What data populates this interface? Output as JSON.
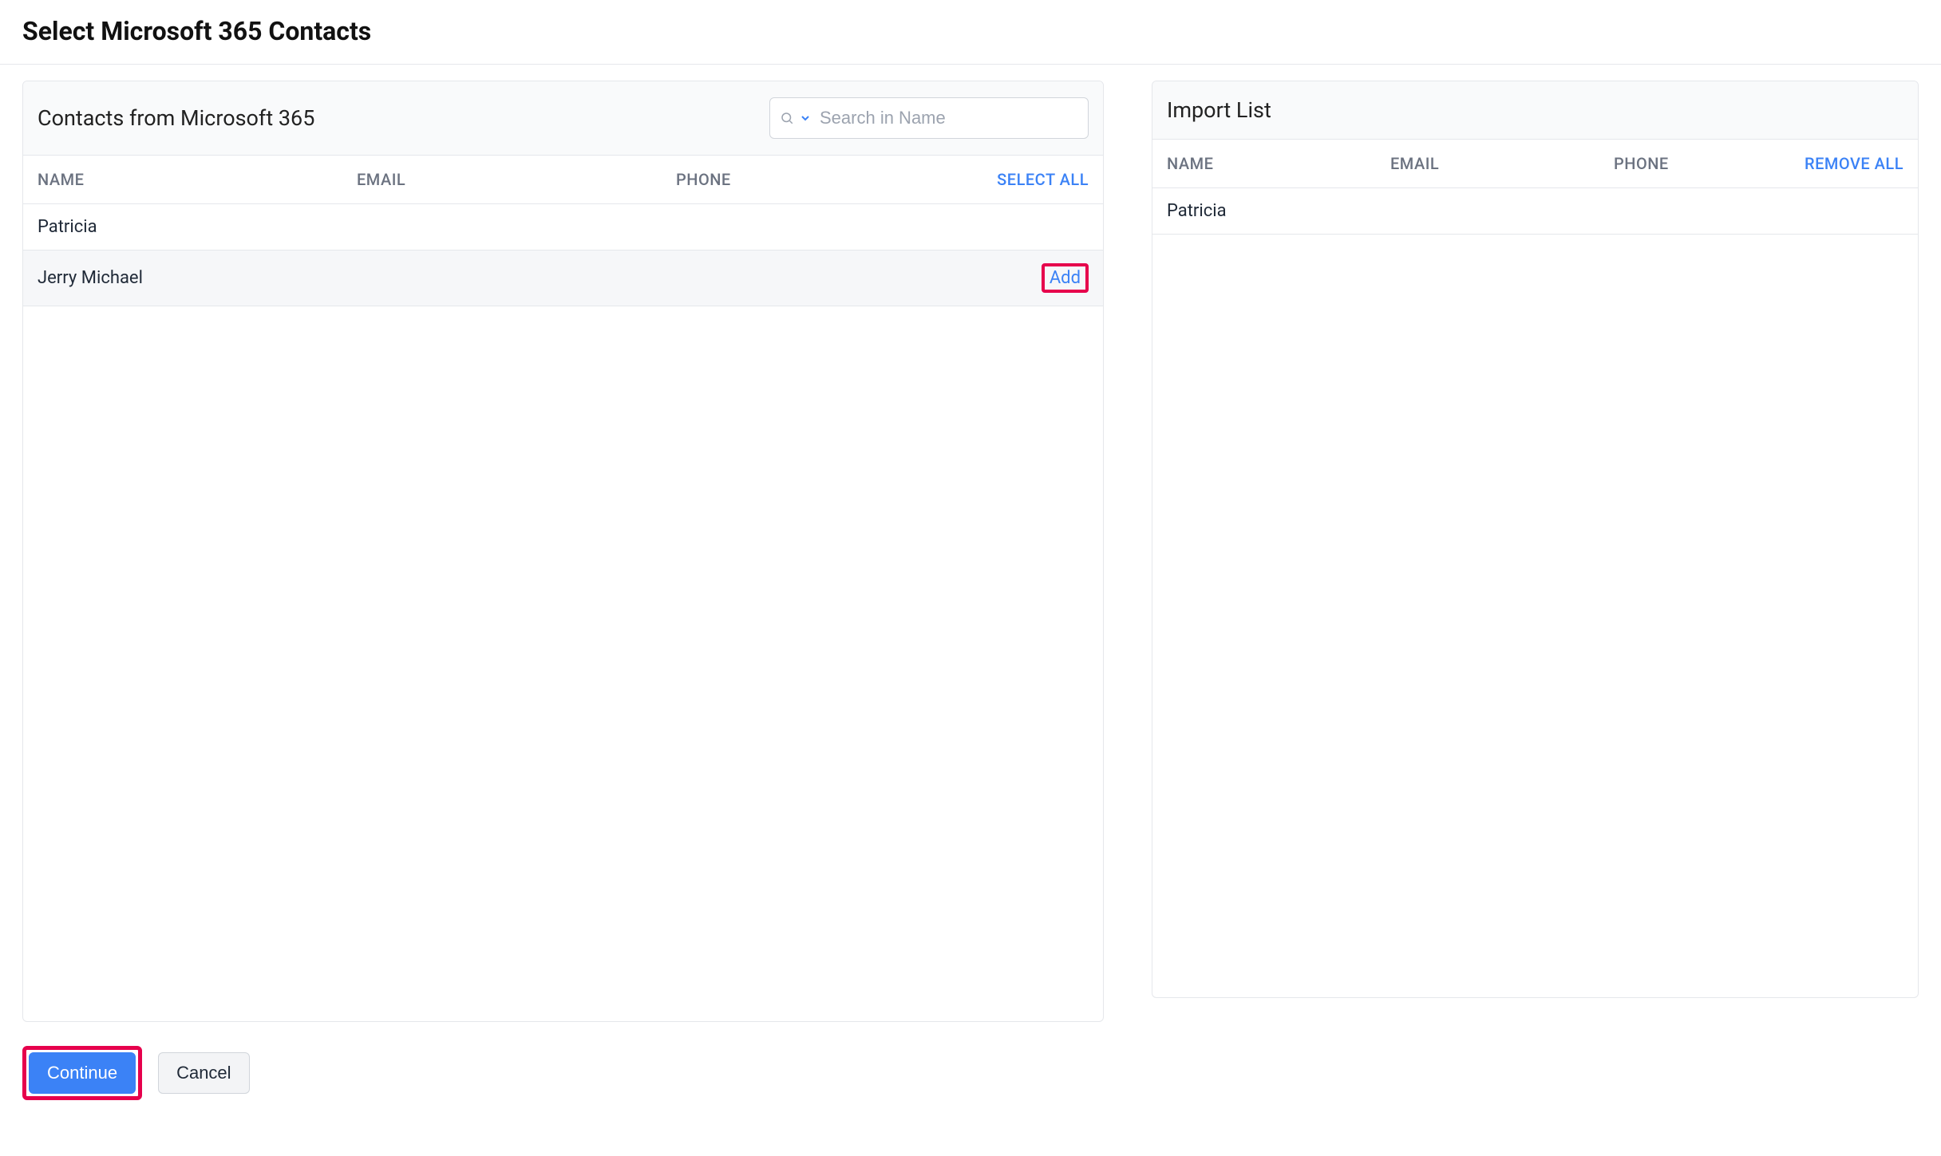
{
  "page": {
    "title": "Select Microsoft 365 Contacts"
  },
  "contacts_panel": {
    "title": "Contacts from Microsoft 365",
    "search_placeholder": "Search in Name",
    "columns": {
      "name": "NAME",
      "email": "EMAIL",
      "phone": "PHONE",
      "select_all": "SELECT ALL"
    },
    "rows": [
      {
        "name": "Patricia",
        "email": "",
        "phone": "",
        "action": ""
      },
      {
        "name": "Jerry Michael",
        "email": "",
        "phone": "",
        "action": "Add"
      }
    ]
  },
  "import_panel": {
    "title": "Import List",
    "columns": {
      "name": "NAME",
      "email": "EMAIL",
      "phone": "PHONE",
      "remove_all": "REMOVE ALL"
    },
    "rows": [
      {
        "name": "Patricia",
        "email": "",
        "phone": ""
      }
    ]
  },
  "footer": {
    "continue": "Continue",
    "cancel": "Cancel"
  }
}
